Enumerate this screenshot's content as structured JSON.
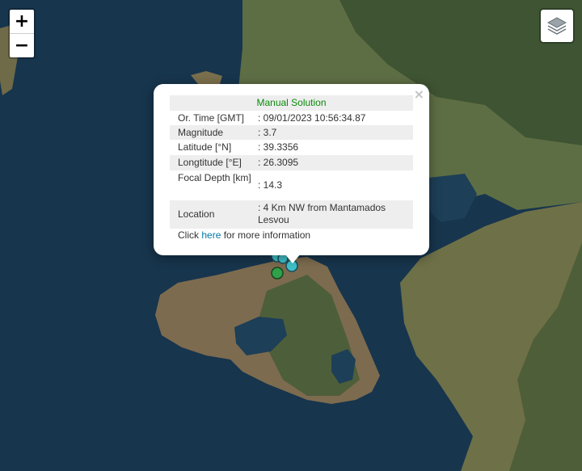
{
  "controls": {
    "zoom_in": "+",
    "zoom_out": "−"
  },
  "layers_icon": "layers-icon",
  "popup": {
    "title": "Manual Solution",
    "title_color": "#0a8a0a",
    "close": "×",
    "rows": [
      {
        "key": "Or. Time [GMT]",
        "value": ": 09/01/2023 10:56:34.87"
      },
      {
        "key": "Magnitude",
        "value": ": 3.7"
      },
      {
        "key": "Latitude [°N]",
        "value": ": 39.3356"
      },
      {
        "key": "Longtitude [°E]",
        "value": ": 26.3095"
      },
      {
        "key": "Focal Depth [km]",
        "value": ": 14.3"
      },
      {
        "key": "Location",
        "value": ": 4 Km NW from Mantamados Lesvou"
      }
    ],
    "footer_pre": "Click ",
    "footer_link": "here",
    "footer_post": " for more information",
    "link_color": "#0078a8"
  },
  "markers": {
    "colors": [
      "#3fc1c9",
      "#2fa14a"
    ]
  }
}
